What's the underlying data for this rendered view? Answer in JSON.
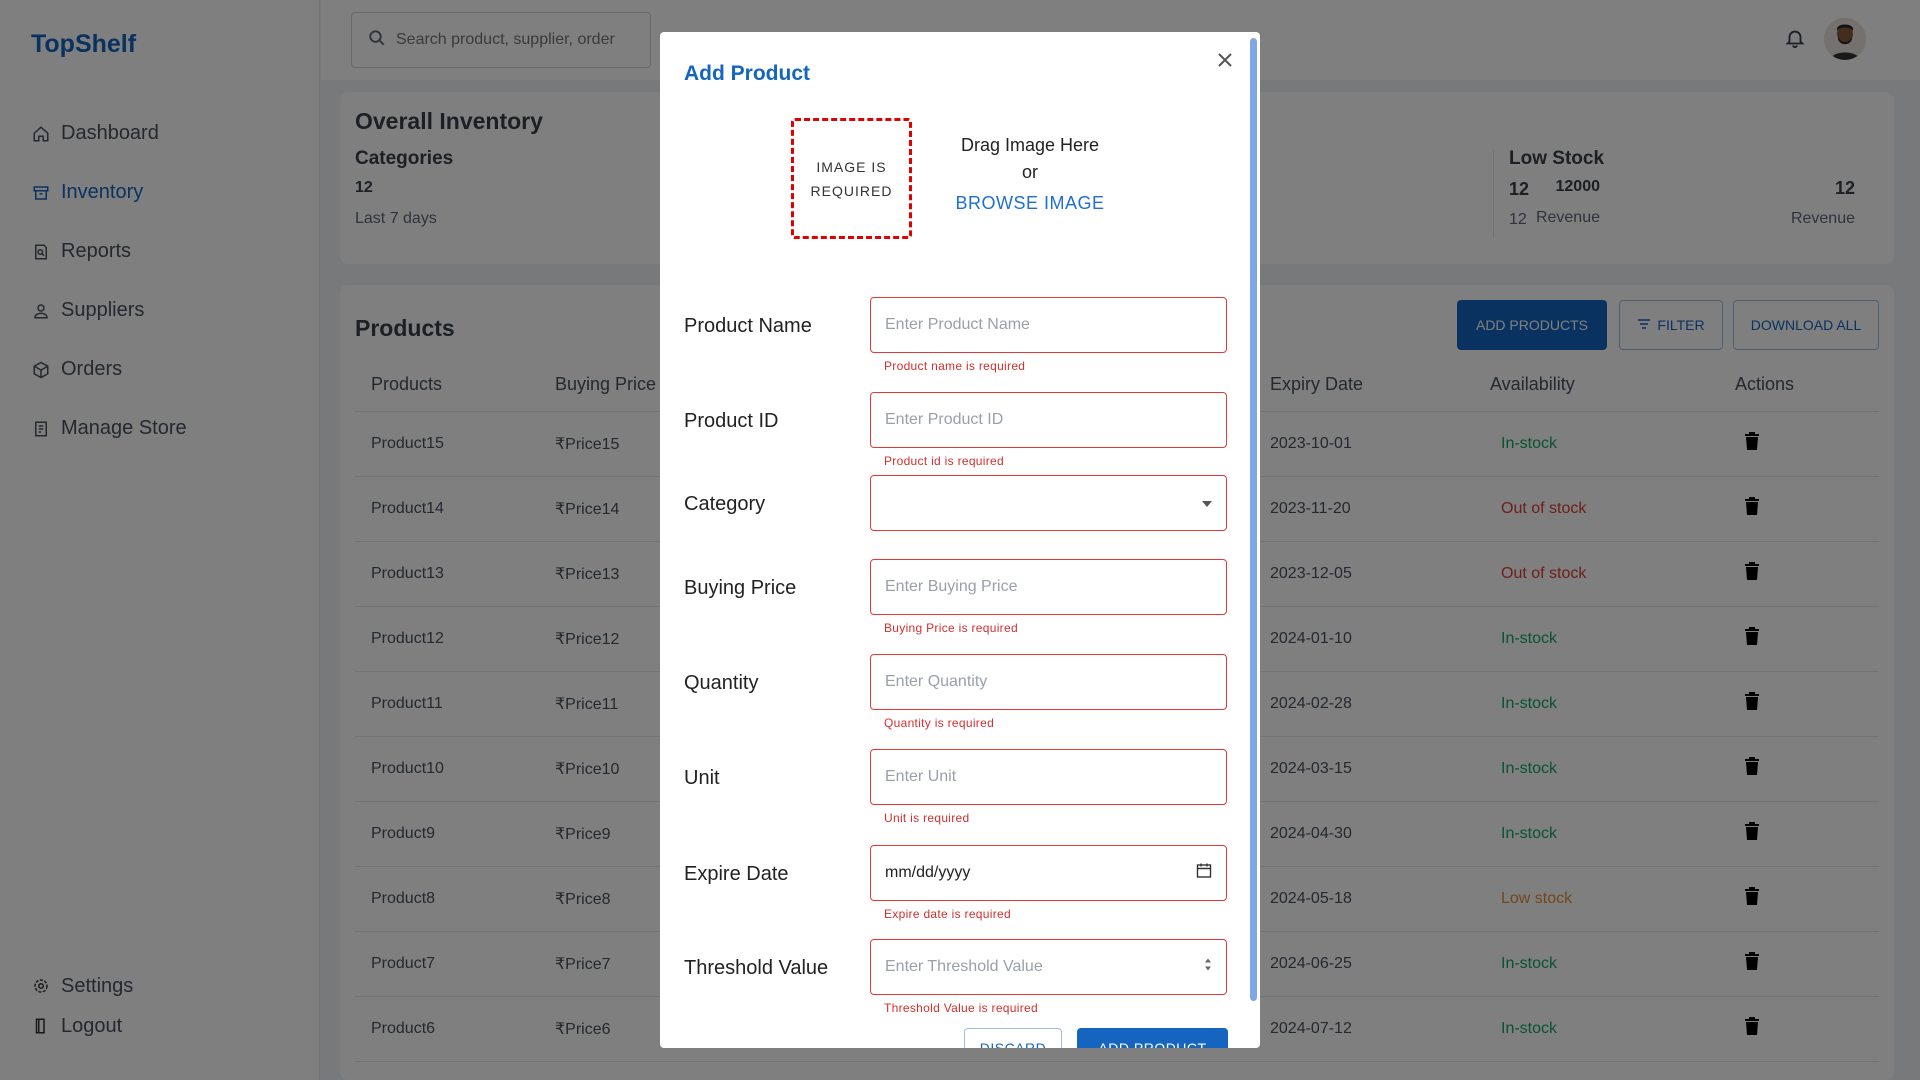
{
  "app": {
    "name": "TopShelf"
  },
  "sidebar": {
    "items": [
      {
        "label": "Dashboard",
        "icon": "home-icon"
      },
      {
        "label": "Inventory",
        "icon": "inventory-icon"
      },
      {
        "label": "Reports",
        "icon": "reports-icon"
      },
      {
        "label": "Suppliers",
        "icon": "user-icon"
      },
      {
        "label": "Orders",
        "icon": "box-icon"
      },
      {
        "label": "Manage Store",
        "icon": "store-icon"
      }
    ],
    "bottom": [
      {
        "label": "Settings",
        "icon": "gear-icon"
      },
      {
        "label": "Logout",
        "icon": "logout-icon"
      }
    ]
  },
  "topbar": {
    "search_placeholder": "Search product, supplier, order"
  },
  "overall": {
    "title": "Overall Inventory",
    "categories": {
      "title": "Categories",
      "value": "12",
      "sub": "Last 7 days"
    },
    "revenue_value": "12000",
    "revenue_label": "Revenue",
    "low_stock": {
      "title": "Low Stock",
      "value": "12",
      "sub": "12",
      "right_value": "12",
      "right_label": "Revenue"
    }
  },
  "products": {
    "title": "Products",
    "buttons": {
      "add": "ADD PRODUCTS",
      "filter": "FILTER",
      "download": "DOWNLOAD ALL"
    },
    "columns": [
      "Products",
      "Buying Price",
      "Expiry Date",
      "Availability",
      "Actions"
    ],
    "rows": [
      {
        "name": "Product15",
        "price": "₹Price15",
        "expiry": "2023-10-01",
        "availability": "In-stock",
        "status": "in"
      },
      {
        "name": "Product14",
        "price": "₹Price14",
        "expiry": "2023-11-20",
        "availability": "Out of stock",
        "status": "out"
      },
      {
        "name": "Product13",
        "price": "₹Price13",
        "expiry": "2023-12-05",
        "availability": "Out of stock",
        "status": "out"
      },
      {
        "name": "Product12",
        "price": "₹Price12",
        "expiry": "2024-01-10",
        "availability": "In-stock",
        "status": "in"
      },
      {
        "name": "Product11",
        "price": "₹Price11",
        "expiry": "2024-02-28",
        "availability": "In-stock",
        "status": "in"
      },
      {
        "name": "Product10",
        "price": "₹Price10",
        "expiry": "2024-03-15",
        "availability": "In-stock",
        "status": "in"
      },
      {
        "name": "Product9",
        "price": "₹Price9",
        "expiry": "2024-04-30",
        "availability": "In-stock",
        "status": "in"
      },
      {
        "name": "Product8",
        "price": "₹Price8",
        "expiry": "2024-05-18",
        "availability": "Low stock",
        "status": "low"
      },
      {
        "name": "Product7",
        "price": "₹Price7",
        "expiry": "2024-06-25",
        "availability": "In-stock",
        "status": "in"
      },
      {
        "name": "Product6",
        "price": "₹Price6",
        "expiry": "2024-07-12",
        "availability": "In-stock",
        "status": "in"
      }
    ]
  },
  "modal": {
    "title": "Add Product",
    "image_box": "IMAGE IS REQUIRED",
    "drag_text": "Drag Image Here",
    "or_text": "or",
    "browse": "BROWSE IMAGE",
    "fields": [
      {
        "label": "Product Name",
        "placeholder": "Enter Product Name",
        "error": "Product name is required"
      },
      {
        "label": "Product ID",
        "placeholder": "Enter Product ID",
        "error": "Product id is required"
      },
      {
        "label": "Category",
        "placeholder": "",
        "error": ""
      },
      {
        "label": "Buying Price",
        "placeholder": "Enter Buying Price",
        "error": "Buying Price is required"
      },
      {
        "label": "Quantity",
        "placeholder": "Enter Quantity",
        "error": "Quantity is required"
      },
      {
        "label": "Unit",
        "placeholder": "Enter Unit",
        "error": "Unit is required"
      },
      {
        "label": "Expire Date",
        "placeholder": "mm/dd/yyyy",
        "error": "Expire date is required"
      },
      {
        "label": "Threshold Value",
        "placeholder": "Enter Threshold Value",
        "error": "Threshold Value is required"
      }
    ],
    "discard": "DISCARD",
    "submit": "ADD PRODUCT"
  },
  "colors": {
    "accent": "#1565c0",
    "error": "#d32f2f",
    "in_stock": "#10a760",
    "out_of_stock": "#da3e33",
    "low_stock": "#e19133"
  }
}
